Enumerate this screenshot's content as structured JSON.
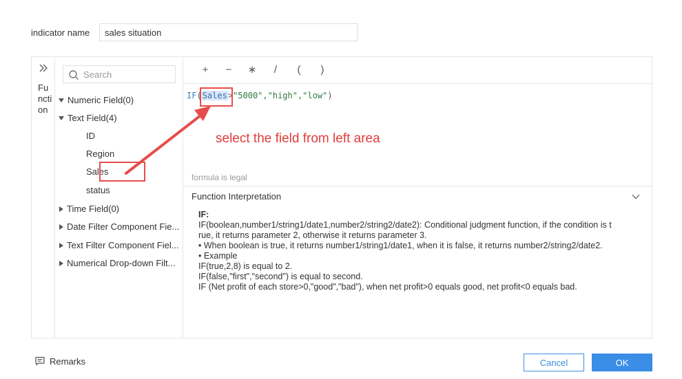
{
  "indicator": {
    "label": "indicator name",
    "value": "sales situation"
  },
  "function_strip": {
    "expand_icon": "double-chevron-right-icon",
    "label": "Function"
  },
  "field_panel": {
    "search_placeholder": "Search",
    "groups": [
      {
        "label": "Numeric Field(0)",
        "expanded": false
      },
      {
        "label": "Text Field(4)",
        "expanded": true,
        "children": [
          "ID",
          "Region",
          "Sales",
          "status"
        ]
      },
      {
        "label": "Time Field(0)",
        "expanded": false
      },
      {
        "label": "Date Filter Component Fie...",
        "expanded": false
      },
      {
        "label": "Text Filter Component Fiel...",
        "expanded": false
      },
      {
        "label": "Numerical Drop-down Filt...",
        "expanded": false
      }
    ]
  },
  "operators": [
    "+",
    "−",
    "∗",
    "/",
    "(",
    ")"
  ],
  "formula": {
    "fn": "IF",
    "open": "(",
    "field": "Sales",
    "operator": ">",
    "rest": "\"5000\",\"high\",\"low\"",
    "close": ")"
  },
  "annotation": "select the field from left area",
  "status": "formula is legal",
  "interpretation": {
    "title": "Function Interpretation",
    "heading": "IF:",
    "lines": [
      "IF(boolean,number1/string1/date1,number2/string2/date2): Conditional judgment function, if the condition is t",
      "rue, it returns parameter 2, otherwise it returns parameter 3.",
      "• When boolean is true, it returns number1/string1/date1, when it is false, it returns number2/string2/date2.",
      "• Example",
      "IF(true,2,8) is equal to 2.",
      "IF(false,\"first\",\"second\") is equal to second.",
      "IF (Net profit of each store>0,\"good\",\"bad\"), when net profit>0 equals good, net profit<0 equals bad."
    ]
  },
  "footer": {
    "remarks": "Remarks",
    "cancel": "Cancel",
    "ok": "OK"
  },
  "colors": {
    "accent": "#3a8ee6",
    "annotation_red": "#e23b3b",
    "token_bg": "#d8e6f7"
  }
}
